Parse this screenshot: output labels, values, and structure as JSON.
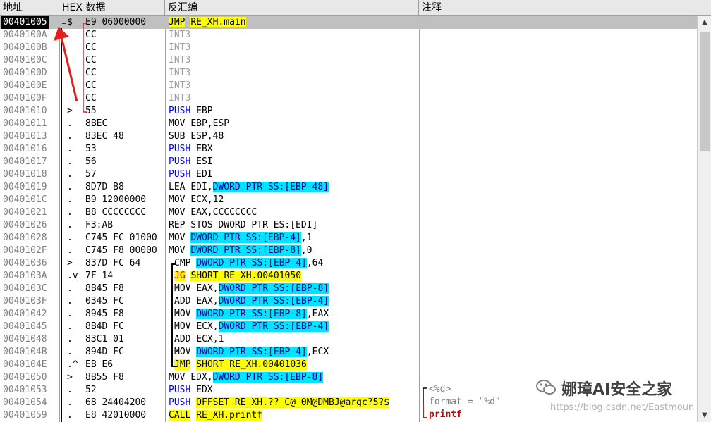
{
  "header": {
    "addr": "地址",
    "hex": "HEX 数据",
    "disasm": "反汇编",
    "comment": "注释"
  },
  "rows": [
    {
      "addr": "00401005",
      "mark": "$",
      "hex": "E9 06000000",
      "op": "JMP",
      "ops": "RE_XH.main"
    },
    {
      "addr": "0040100A",
      "mark": "",
      "hex": "CC",
      "op": "INT3",
      "ops": ""
    },
    {
      "addr": "0040100B",
      "mark": "",
      "hex": "CC",
      "op": "INT3",
      "ops": ""
    },
    {
      "addr": "0040100C",
      "mark": "",
      "hex": "CC",
      "op": "INT3",
      "ops": ""
    },
    {
      "addr": "0040100D",
      "mark": "",
      "hex": "CC",
      "op": "INT3",
      "ops": ""
    },
    {
      "addr": "0040100E",
      "mark": "",
      "hex": "CC",
      "op": "INT3",
      "ops": ""
    },
    {
      "addr": "0040100F",
      "mark": "",
      "hex": "CC",
      "op": "INT3",
      "ops": ""
    },
    {
      "addr": "00401010",
      "mark": ">",
      "hex": "55",
      "op": "PUSH",
      "ops": "EBP"
    },
    {
      "addr": "00401011",
      "mark": ".",
      "hex": "8BEC",
      "op": "MOV",
      "ops": "EBP,ESP"
    },
    {
      "addr": "00401013",
      "mark": ".",
      "hex": "83EC 48",
      "op": "SUB",
      "ops": "ESP,48"
    },
    {
      "addr": "00401016",
      "mark": ".",
      "hex": "53",
      "op": "PUSH",
      "ops": "EBX"
    },
    {
      "addr": "00401017",
      "mark": ".",
      "hex": "56",
      "op": "PUSH",
      "ops": "ESI"
    },
    {
      "addr": "00401018",
      "mark": ".",
      "hex": "57",
      "op": "PUSH",
      "ops": "EDI"
    },
    {
      "addr": "00401019",
      "mark": ".",
      "hex": "8D7D B8",
      "op": "LEA",
      "ops": "EDI,DWORD PTR SS:[EBP-48]"
    },
    {
      "addr": "0040101C",
      "mark": ".",
      "hex": "B9 12000000",
      "op": "MOV",
      "ops": "ECX,12"
    },
    {
      "addr": "00401021",
      "mark": ".",
      "hex": "B8 CCCCCCCC",
      "op": "MOV",
      "ops": "EAX,CCCCCCCC"
    },
    {
      "addr": "00401026",
      "mark": ".",
      "hex": "F3:AB",
      "op": "REP STOS",
      "ops": "DWORD PTR ES:[EDI]"
    },
    {
      "addr": "00401028",
      "mark": ".",
      "hex": "C745 FC 01000",
      "op": "MOV",
      "ops": "DWORD PTR SS:[EBP-4],1"
    },
    {
      "addr": "0040102F",
      "mark": ".",
      "hex": "C745 F8 00000",
      "op": "MOV",
      "ops": "DWORD PTR SS:[EBP-8],0"
    },
    {
      "addr": "00401036",
      "mark": ">",
      "hex": "837D FC 64",
      "op": "CMP",
      "ops": "DWORD PTR SS:[EBP-4],64"
    },
    {
      "addr": "0040103A",
      "mark": ".v",
      "hex": "7F 14",
      "op": "JG",
      "ops": "SHORT RE_XH.00401050"
    },
    {
      "addr": "0040103C",
      "mark": ".",
      "hex": "8B45 F8",
      "op": "MOV",
      "ops": "EAX,DWORD PTR SS:[EBP-8]"
    },
    {
      "addr": "0040103F",
      "mark": ".",
      "hex": "0345 FC",
      "op": "ADD",
      "ops": "EAX,DWORD PTR SS:[EBP-4]"
    },
    {
      "addr": "00401042",
      "mark": ".",
      "hex": "8945 F8",
      "op": "MOV",
      "ops": "DWORD PTR SS:[EBP-8],EAX"
    },
    {
      "addr": "00401045",
      "mark": ".",
      "hex": "8B4D FC",
      "op": "MOV",
      "ops": "ECX,DWORD PTR SS:[EBP-4]"
    },
    {
      "addr": "00401048",
      "mark": ".",
      "hex": "83C1 01",
      "op": "ADD",
      "ops": "ECX,1"
    },
    {
      "addr": "0040104B",
      "mark": ".",
      "hex": "894D FC",
      "op": "MOV",
      "ops": "DWORD PTR SS:[EBP-4],ECX"
    },
    {
      "addr": "0040104E",
      "mark": ".^",
      "hex": "EB E6",
      "op": "JMP",
      "ops": "SHORT RE_XH.00401036"
    },
    {
      "addr": "00401050",
      "mark": ">",
      "hex": "8B55 F8",
      "op": "MOV",
      "ops": "EDX,DWORD PTR SS:[EBP-8]"
    },
    {
      "addr": "00401053",
      "mark": ".",
      "hex": "52",
      "op": "PUSH",
      "ops": "EDX"
    },
    {
      "addr": "00401054",
      "mark": ".",
      "hex": "68 24404200",
      "op": "PUSH",
      "ops": "OFFSET RE_XH.??_C@_0M@DMBJ@argc?5?$"
    },
    {
      "addr": "00401059",
      "mark": ".",
      "hex": "E8 42010000",
      "op": "CALL",
      "ops": "RE_XH.printf"
    }
  ],
  "comments": {
    "c1": "<%d>",
    "c2": "format = \"%d\"",
    "c3": "printf"
  },
  "watermark": {
    "brand": "娜璋AI安全之家",
    "url": "https://blog.csdn.net/Eastmoun"
  },
  "colors": {
    "highlight_jump": "#ffff00",
    "highlight_mem": "#00e5ff",
    "selection": "#c0c0c0",
    "arrow": "#e0201a"
  }
}
